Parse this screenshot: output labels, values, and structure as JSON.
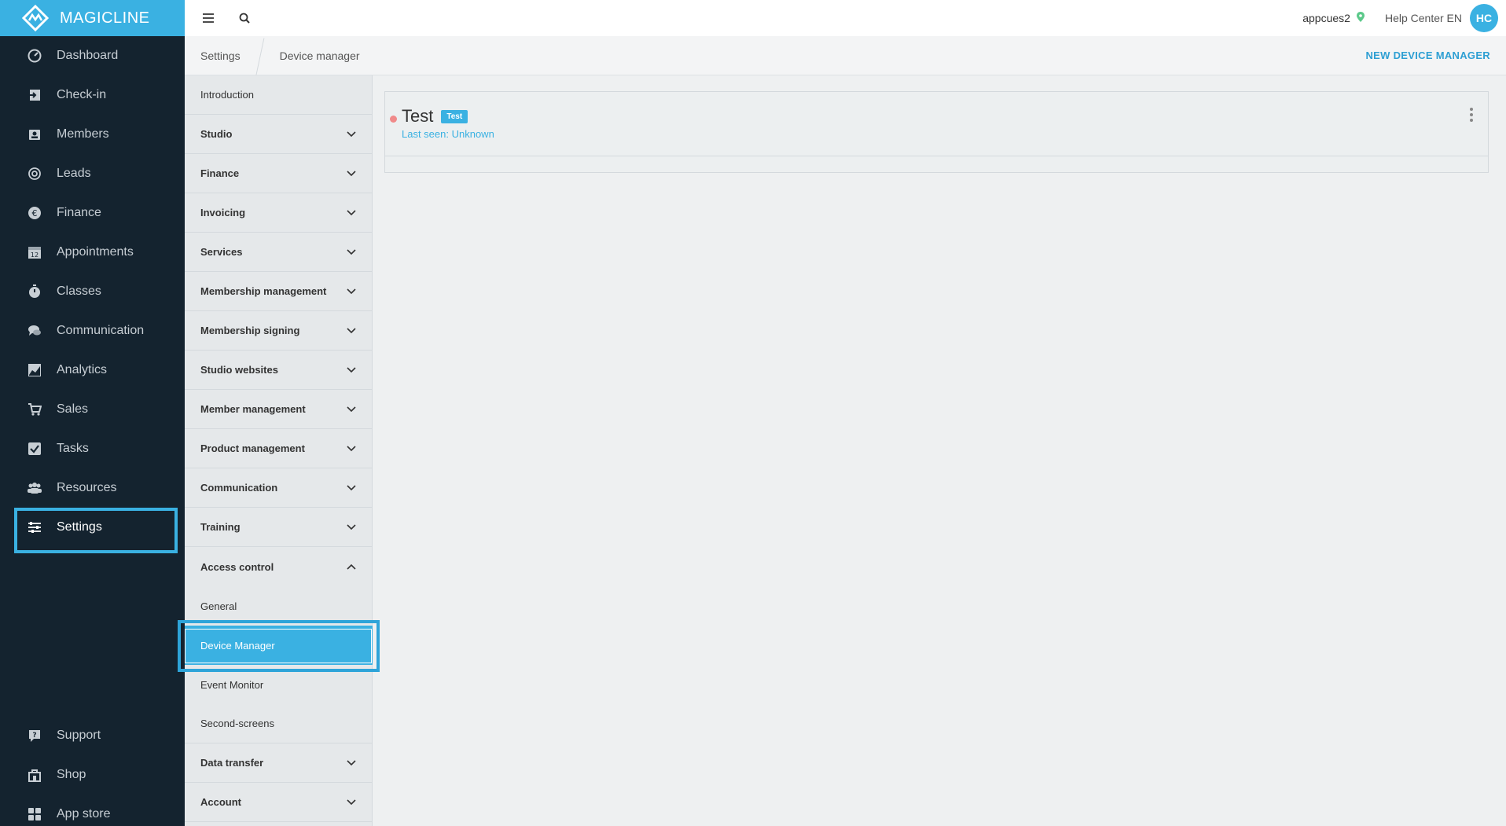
{
  "app": {
    "logo_text": "MAGICLINE"
  },
  "sidebar": {
    "items": [
      {
        "label": "Dashboard",
        "icon": "gauge-icon"
      },
      {
        "label": "Check-in",
        "icon": "check-in-icon"
      },
      {
        "label": "Members",
        "icon": "member-card-icon"
      },
      {
        "label": "Leads",
        "icon": "target-icon"
      },
      {
        "label": "Finance",
        "icon": "euro-icon"
      },
      {
        "label": "Appointments",
        "icon": "calendar-icon"
      },
      {
        "label": "Classes",
        "icon": "stopwatch-icon"
      },
      {
        "label": "Communication",
        "icon": "chat-icon"
      },
      {
        "label": "Analytics",
        "icon": "chart-icon"
      },
      {
        "label": "Sales",
        "icon": "cart-icon"
      },
      {
        "label": "Tasks",
        "icon": "checkbox-icon"
      },
      {
        "label": "Resources",
        "icon": "people-icon"
      },
      {
        "label": "Settings",
        "icon": "sliders-icon",
        "active": true
      },
      {
        "label": "Support",
        "icon": "help-icon"
      },
      {
        "label": "Shop",
        "icon": "shop-icon"
      },
      {
        "label": "App store",
        "icon": "apps-icon"
      }
    ]
  },
  "topbar": {
    "username": "appcues2",
    "help_center": "Help Center EN",
    "avatar_initials": "HC"
  },
  "breadcrumb": {
    "items": [
      "Settings",
      "Device manager"
    ],
    "new_button": "NEW DEVICE MANAGER"
  },
  "submenu": {
    "items": [
      {
        "label": "Introduction"
      },
      {
        "label": "Studio"
      },
      {
        "label": "Finance"
      },
      {
        "label": "Invoicing"
      },
      {
        "label": "Services"
      },
      {
        "label": "Membership management"
      },
      {
        "label": "Membership signing"
      },
      {
        "label": "Studio websites"
      },
      {
        "label": "Member management"
      },
      {
        "label": "Product management"
      },
      {
        "label": "Communication"
      },
      {
        "label": "Training"
      },
      {
        "label": "Access control"
      },
      {
        "label": "General"
      },
      {
        "label": "Device Manager"
      },
      {
        "label": "Event Monitor"
      },
      {
        "label": "Second-screens"
      },
      {
        "label": "Data transfer"
      },
      {
        "label": "Account"
      }
    ]
  },
  "device": {
    "name": "Test",
    "tag": "Test",
    "last_seen": "Last seen: Unknown",
    "status_color": "#f08a8a"
  },
  "colors": {
    "accent": "#3ab1e2",
    "sidebar_bg": "#14232f"
  }
}
